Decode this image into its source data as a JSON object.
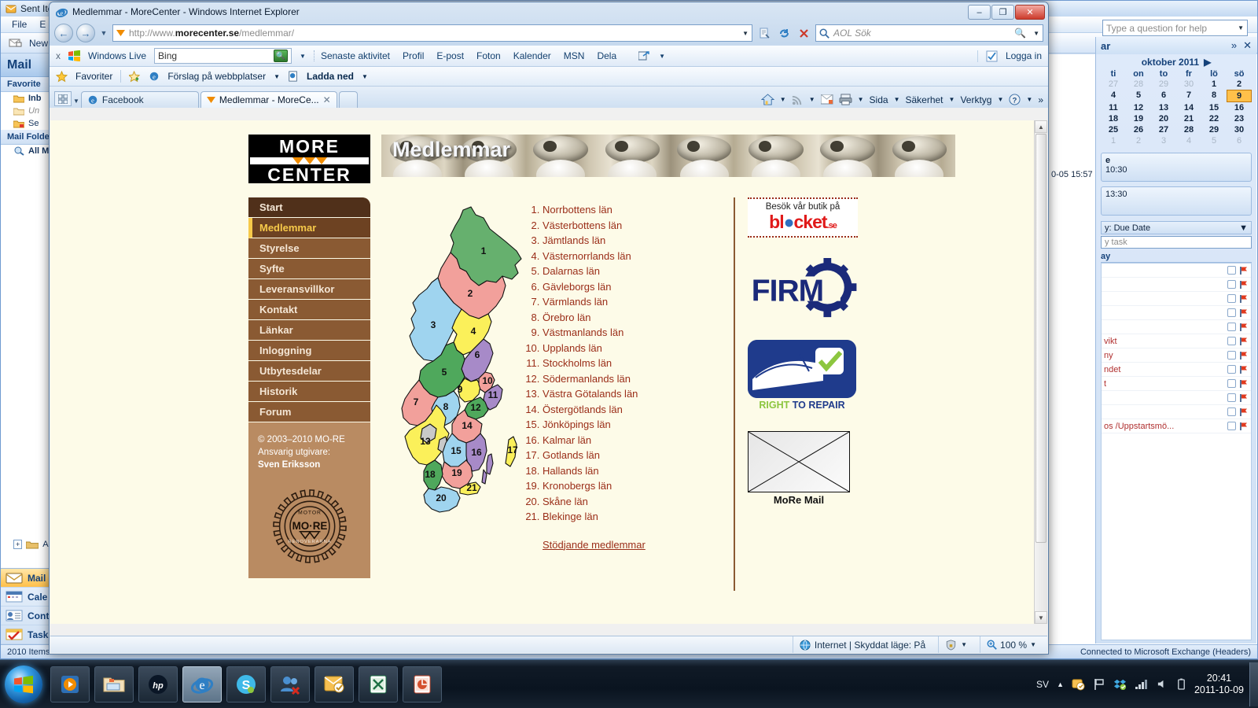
{
  "outlook": {
    "title": "Sent Items",
    "menu": [
      "File",
      "E"
    ],
    "toolbar_new": "New",
    "nav_header": "Mail",
    "favorite_section": "Favorite",
    "folders": [
      {
        "label": "Inb",
        "style": "sel"
      },
      {
        "label": "Un",
        "style": "gray"
      },
      {
        "label": "Se",
        "style": "normal"
      }
    ],
    "mail_folders_section": "Mail Folders",
    "all_mail": "All Ma",
    "archive": "Ar",
    "buttons": [
      {
        "label": "Mail",
        "active": true
      },
      {
        "label": "Cale",
        "active": false
      },
      {
        "label": "Cont",
        "active": false
      },
      {
        "label": "Task",
        "active": false
      }
    ],
    "status_left": "2010 Items",
    "status_right": "Connected to Microsoft Exchange (Headers)",
    "help_placeholder": "Type a question for help"
  },
  "todobar": {
    "title": "ar",
    "expand_icon": "»",
    "close_icon": "✕",
    "calendar": {
      "month": "oktober 2011",
      "next_icon": "▶",
      "dow": [
        "ti",
        "on",
        "to",
        "fr",
        "lö",
        "sö"
      ],
      "weeks": [
        [
          {
            "d": "27",
            "dim": true
          },
          {
            "d": "28",
            "dim": true
          },
          {
            "d": "29",
            "dim": true
          },
          {
            "d": "30",
            "dim": true
          },
          {
            "d": "1"
          },
          {
            "d": "2"
          }
        ],
        [
          {
            "d": "4"
          },
          {
            "d": "5"
          },
          {
            "d": "6"
          },
          {
            "d": "7"
          },
          {
            "d": "8"
          },
          {
            "d": "9",
            "today": true
          }
        ],
        [
          {
            "d": "11"
          },
          {
            "d": "12"
          },
          {
            "d": "13"
          },
          {
            "d": "14"
          },
          {
            "d": "15"
          },
          {
            "d": "16"
          }
        ],
        [
          {
            "d": "18"
          },
          {
            "d": "19"
          },
          {
            "d": "20"
          },
          {
            "d": "21"
          },
          {
            "d": "22"
          },
          {
            "d": "23"
          }
        ],
        [
          {
            "d": "25"
          },
          {
            "d": "26"
          },
          {
            "d": "27"
          },
          {
            "d": "28"
          },
          {
            "d": "29"
          },
          {
            "d": "30"
          }
        ],
        [
          {
            "d": "1",
            "dim": true
          },
          {
            "d": "2",
            "dim": true
          },
          {
            "d": "3",
            "dim": true
          },
          {
            "d": "4",
            "dim": true
          },
          {
            "d": "5",
            "dim": true
          },
          {
            "d": "6",
            "dim": true
          }
        ]
      ]
    },
    "appointments": [
      {
        "title": "e",
        "time": "10:30"
      },
      {
        "title": "",
        "time": "13:30"
      }
    ],
    "sort_label": "y: Due Date",
    "new_task_placeholder": "y task",
    "group_label": "ay",
    "tasks": [
      {
        "text": ""
      },
      {
        "text": ""
      },
      {
        "text": ""
      },
      {
        "text": ""
      },
      {
        "text": ""
      },
      {
        "text": "vikt"
      },
      {
        "text": "ny"
      },
      {
        "text": "ndet"
      },
      {
        "text": "t"
      },
      {
        "text": ""
      },
      {
        "text": ""
      },
      {
        "text": "os /Uppstartsmö..."
      }
    ],
    "timestamp": "0-05 15:57"
  },
  "ie": {
    "window_title": "Medlemmar - MoreCenter - Windows Internet Explorer",
    "window_buttons": {
      "minimize": "–",
      "maximize": "❐",
      "close": "✕"
    },
    "back_icon": "←",
    "forward_icon": "→",
    "address": {
      "prefix": "http://www.",
      "host": "morecenter.se",
      "path": "/medlemmar/"
    },
    "address_icons": {
      "compat": "compat-view-icon",
      "refresh": "↻",
      "stop": "✕"
    },
    "search_placeholder": "AOL Sök",
    "windows_live": {
      "close": "x",
      "brand": "Windows Live",
      "search_value": "Bing",
      "links": [
        "Senaste aktivitet",
        "Profil",
        "E-post",
        "Foton",
        "Kalender",
        "MSN",
        "Dela"
      ],
      "signin": "Logga in"
    },
    "favbar": [
      "Favoriter",
      "Förslag på webbplatser",
      "Ladda ned"
    ],
    "tabs": [
      {
        "label": "Facebook",
        "active": false
      },
      {
        "label": "Medlemmar - MoreCe...",
        "active": true
      }
    ],
    "command_bar": [
      "Sida",
      "Säkerhet",
      "Verktyg"
    ],
    "status": {
      "zone": "Internet | Skyddat läge: På",
      "zoom": "100 %"
    }
  },
  "site": {
    "logo": {
      "line1": "MORE",
      "line2": "CENTER"
    },
    "banner_title": "Medlemmar",
    "nav": [
      {
        "label": "Start",
        "state": "top"
      },
      {
        "label": "Medlemmar",
        "state": "active"
      },
      {
        "label": "Styrelse",
        "state": "normal"
      },
      {
        "label": "Syfte",
        "state": "normal"
      },
      {
        "label": "Leveransvillkor",
        "state": "normal"
      },
      {
        "label": "Kontakt",
        "state": "normal"
      },
      {
        "label": "Länkar",
        "state": "normal"
      },
      {
        "label": "Inloggning",
        "state": "normal"
      },
      {
        "label": "Utbytesdelar",
        "state": "normal"
      },
      {
        "label": "Historik",
        "state": "normal"
      },
      {
        "label": "Forum",
        "state": "normal"
      }
    ],
    "footer": {
      "copyright": "© 2003–2010 MO-RE",
      "publisher_label": "Ansvarig utgivare:",
      "publisher_name": "Sven Eriksson",
      "emblem_top": "MOTOR",
      "emblem_center": "MO·RE",
      "emblem_bottom": "RENOVERARNA"
    },
    "counties": [
      "Norrbottens län",
      "Västerbottens län",
      "Jämtlands län",
      "Västernorrlands län",
      "Dalarnas län",
      "Gävleborgs län",
      "Värmlands län",
      "Örebro län",
      "Västmanlands län",
      "Upplands län",
      "Stockholms län",
      "Södermanlands län",
      "Västra Götalands län",
      "Östergötlands län",
      "Jönköpings län",
      "Kalmar län",
      "Gotlands län",
      "Hallands län",
      "Kronobergs län",
      "Skåne län",
      "Blekinge län"
    ],
    "supporting_link": "Stödjande medlemmar",
    "map_labels": [
      "1",
      "2",
      "3",
      "4",
      "5",
      "6",
      "7",
      "8",
      "9",
      "10",
      "11",
      "12",
      "13",
      "14",
      "15",
      "16",
      "17",
      "18",
      "19",
      "20",
      "21"
    ],
    "sponsors": {
      "blocket": {
        "tagline": "Besök vår butik på",
        "brand": "bl",
        "brand2": "cket",
        "suffix": ".se"
      },
      "firm": {
        "name": "FIRM"
      },
      "r2r": {
        "line1": "RIGHT",
        "line2": "TO REPAIR"
      },
      "more_mail": {
        "caption": "MoRe Mail"
      }
    }
  },
  "taskbar": {
    "apps": [
      {
        "name": "windows-media-player"
      },
      {
        "name": "windows-explorer"
      },
      {
        "name": "hp-app"
      },
      {
        "name": "internet-explorer",
        "active": true
      },
      {
        "name": "skype"
      },
      {
        "name": "messenger"
      },
      {
        "name": "outlook"
      },
      {
        "name": "excel"
      },
      {
        "name": "powerpoint"
      }
    ],
    "tray": {
      "language": "SV",
      "time": "20:41",
      "date": "2011-10-09"
    }
  },
  "colors": {
    "site_bg": "#fdfbe8",
    "nav_brown": "#8a5a33",
    "nav_active": "#6d4222",
    "accent_gold": "#f6c94a",
    "link_red": "#9a2d18",
    "footer_tan": "#b98b62"
  }
}
